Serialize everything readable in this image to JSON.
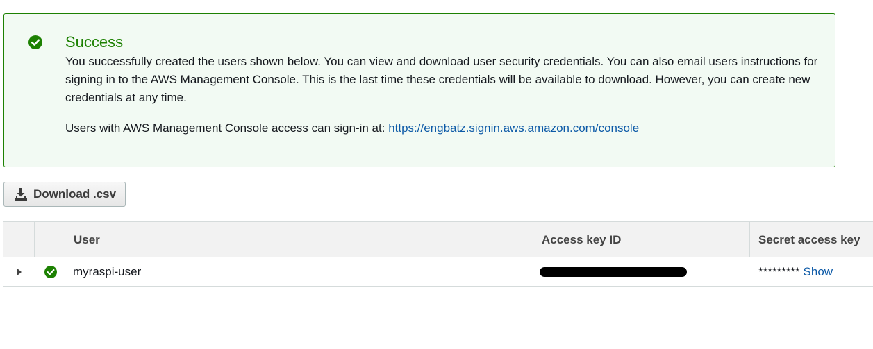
{
  "alert": {
    "status": "success",
    "icon": "check-circle-icon",
    "title": "Success",
    "body": "You successfully created the users shown below. You can view and download user security credentials. You can also email users instructions for signing in to the AWS Management Console. This is the last time these credentials will be available to download. However, you can create new credentials at any time.",
    "signin_prefix": "Users with AWS Management Console access can sign-in at: ",
    "signin_url": "https://engbatz.signin.aws.amazon.com/console"
  },
  "toolbar": {
    "download_icon": "download-icon",
    "download_label": "Download .csv"
  },
  "table": {
    "columns": [
      "",
      "",
      "User",
      "Access key ID",
      "Secret access key"
    ],
    "rows": [
      {
        "user": "myraspi-user",
        "status_icon": "check-circle-icon",
        "access_key_id_redacted": true,
        "secret_masked": "*********",
        "secret_action": "Show"
      }
    ]
  },
  "colors": {
    "success": "#1d8102",
    "alert_bg": "#f2faf3",
    "link": "#0d5aa7",
    "header_bg": "#f2f2f2",
    "border": "#d5dbdb"
  }
}
